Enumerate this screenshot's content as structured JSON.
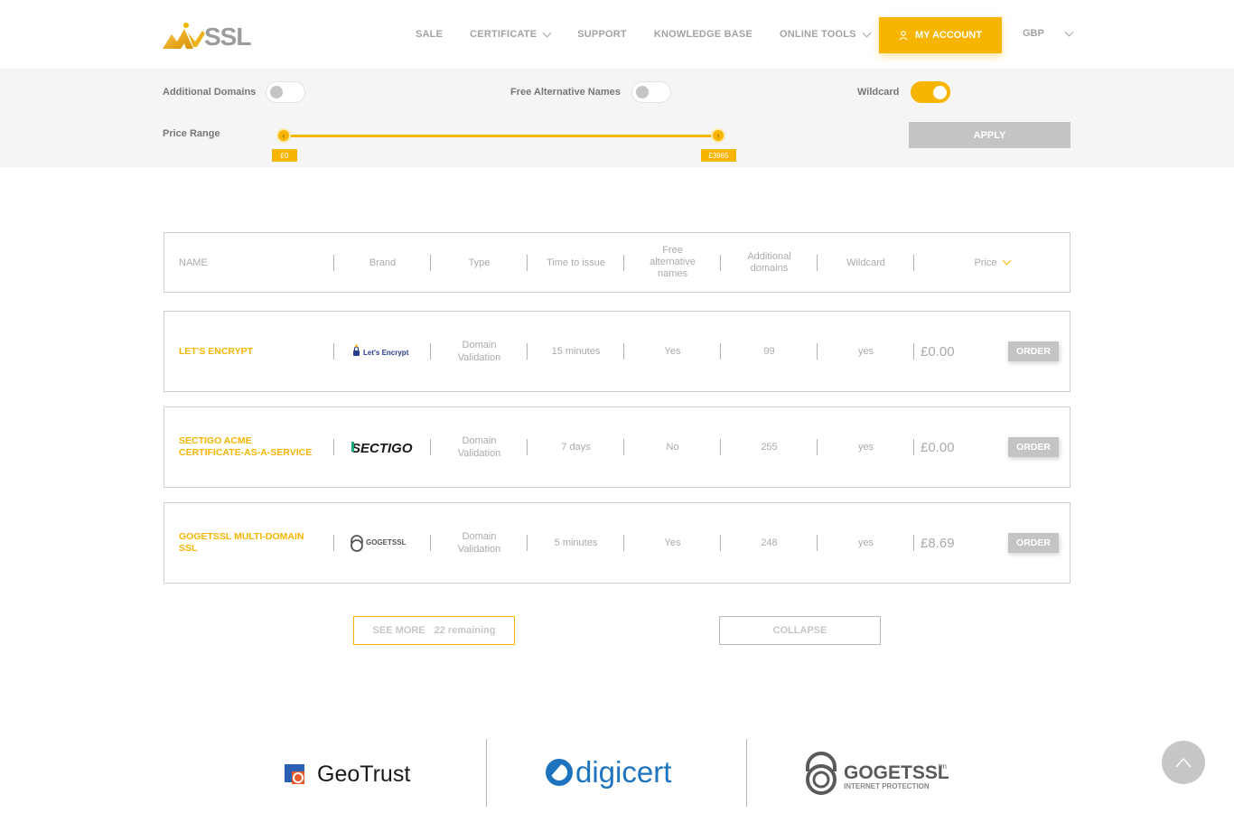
{
  "header": {
    "logo_text": "SSL",
    "nav": [
      "SALE",
      "CERTIFICATE",
      "SUPPORT",
      "KNOWLEDGE BASE",
      "ONLINE TOOLS"
    ],
    "account_label": "MY ACCOUNT",
    "currency": "GBP",
    "accent_color": "#f7b500"
  },
  "filters": {
    "additional_domains_label": "Additional Domains",
    "additional_domains_on": false,
    "free_alt_names_label": "Free Alternative Names",
    "free_alt_names_on": false,
    "wildcard_label": "Wildcard",
    "wildcard_on": true,
    "price_range_label": "Price Range",
    "price_min": "£0",
    "price_max": "£3965",
    "apply_label": "APPLY"
  },
  "table": {
    "columns": [
      "NAME",
      "Brand",
      "Type",
      "Time to issue",
      "Free alternative names",
      "Additional domains",
      "Wildcard",
      "Price"
    ],
    "rows": [
      {
        "name": "LET'S ENCRYPT",
        "brand": "Let's Encrypt",
        "type": "Domain Validation",
        "time": "15 minutes",
        "free_alt": "Yes",
        "domains": "99",
        "wildcard": "yes",
        "price": "£0.00",
        "order": "ORDER"
      },
      {
        "name": "SECTIGO ACME CERTIFICATE-AS-A-SERVICE",
        "brand": "SECTIGO",
        "type": "Domain Validation",
        "time": "7 days",
        "free_alt": "No",
        "domains": "255",
        "wildcard": "yes",
        "price": "£0.00",
        "order": "ORDER"
      },
      {
        "name": "GOGETSSL MULTI-DOMAIN SSL",
        "brand": "GOGETSSL",
        "type": "Domain Validation",
        "time": "5 minutes",
        "free_alt": "Yes",
        "domains": "248",
        "wildcard": "yes",
        "price": "£8.69",
        "order": "ORDER"
      }
    ]
  },
  "see_more": {
    "label": "SEE MORE",
    "remaining": "22 remaining"
  },
  "collapse_label": "COLLAPSE",
  "brands_footer": {
    "geotrust": "GeoTrust",
    "digicert": "digicert",
    "gogetssl": "GOGETSSL",
    "gogetssl_tag": "INTERNET PROTECTION",
    "gogetssl_tm": "tm"
  }
}
